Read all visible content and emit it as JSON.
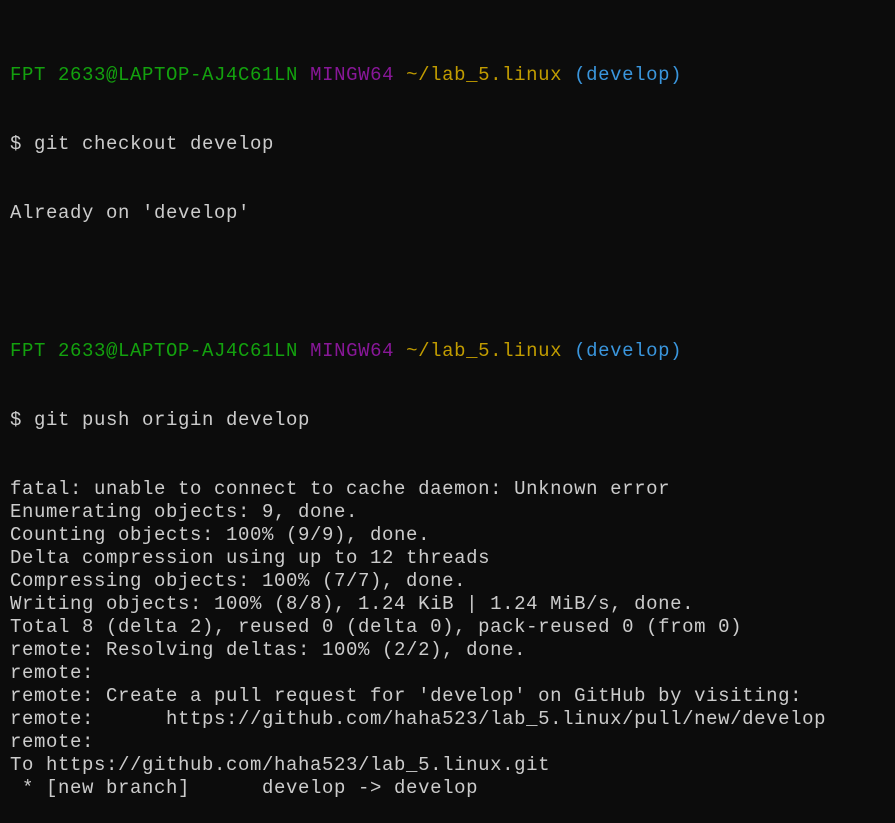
{
  "colors": {
    "background": "#0c0c0c",
    "text": "#cccccc",
    "user_host": "#13a10e",
    "system": "#881798",
    "path": "#c19c00",
    "branch": "#3a96dd"
  },
  "prompts": [
    {
      "user_host": "FPT 2633@LAPTOP-AJ4C61LN",
      "system": "MINGW64",
      "path": "~/lab_5.linux",
      "branch": "(develop)",
      "command": "$ git checkout develop",
      "output": [
        "Already on 'develop'"
      ]
    },
    {
      "user_host": "FPT 2633@LAPTOP-AJ4C61LN",
      "system": "MINGW64",
      "path": "~/lab_5.linux",
      "branch": "(develop)",
      "command": "$ git push origin develop",
      "output": [
        "fatal: unable to connect to cache daemon: Unknown error",
        "Enumerating objects: 9, done.",
        "Counting objects: 100% (9/9), done.",
        "Delta compression using up to 12 threads",
        "Compressing objects: 100% (7/7), done.",
        "Writing objects: 100% (8/8), 1.24 KiB | 1.24 MiB/s, done.",
        "Total 8 (delta 2), reused 0 (delta 0), pack-reused 0 (from 0)",
        "remote: Resolving deltas: 100% (2/2), done.",
        "remote:",
        "remote: Create a pull request for 'develop' on GitHub by visiting:",
        "remote:      https://github.com/haha523/lab_5.linux/pull/new/develop",
        "remote:",
        "To https://github.com/haha523/lab_5.linux.git",
        " * [new branch]      develop -> develop"
      ]
    }
  ]
}
